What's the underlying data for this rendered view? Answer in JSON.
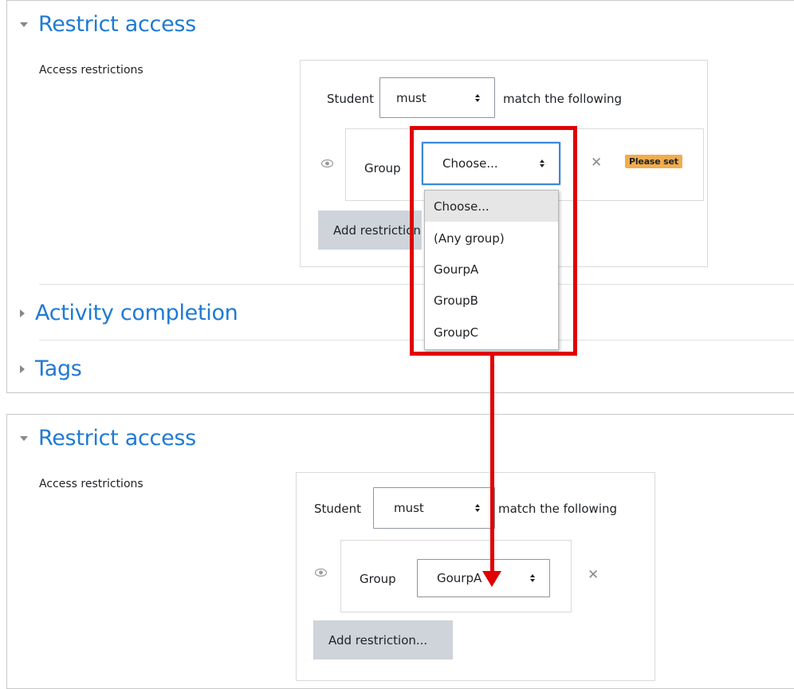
{
  "top": {
    "restrict_title": "Restrict access",
    "access_label": "Access restrictions",
    "student_label": "Student",
    "must_value": "must",
    "match_label": "match the following",
    "group_label": "Group",
    "group_select_value": "Choose...",
    "please_set_badge": "Please set",
    "add_restriction": "Add restriction...",
    "dropdown_options": [
      "Choose...",
      "(Any group)",
      "GourpA",
      "GroupB",
      "GroupC"
    ],
    "activity_title": "Activity completion",
    "tags_title": "Tags"
  },
  "bottom": {
    "restrict_title": "Restrict access",
    "access_label": "Access restrictions",
    "student_label": "Student",
    "must_value": "must",
    "match_label": "match the following",
    "group_label": "Group",
    "group_select_value": "GourpA",
    "add_restriction": "Add restriction..."
  },
  "colors": {
    "section_title": "#1f7ad3",
    "highlight": "#e00000",
    "badge": "#f0ad4e",
    "button": "#ced4da"
  },
  "icons": [
    "eye-icon",
    "close-icon",
    "expand-triangle-icon",
    "collapse-triangle-icon",
    "select-arrows-icon"
  ]
}
